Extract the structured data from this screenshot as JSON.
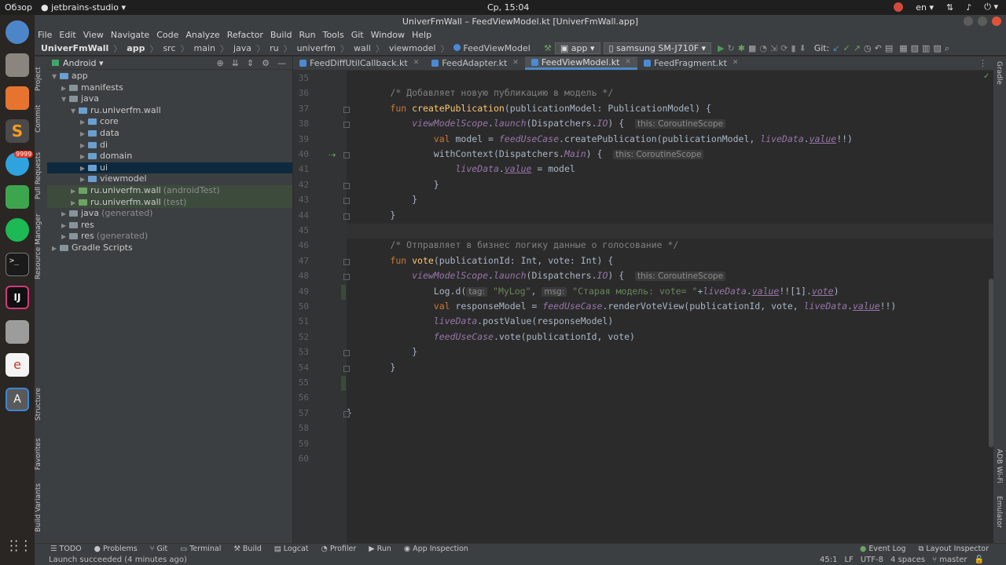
{
  "topbar": {
    "activities": "Обзор",
    "app": "jetbrains-studio",
    "clock": "Ср, 15:04",
    "lang": "en"
  },
  "dock": {
    "telegram_badge": "9999"
  },
  "window": {
    "title": "UniverFmWall – FeedViewModel.kt [UniverFmWall.app]"
  },
  "menu": [
    "File",
    "Edit",
    "View",
    "Navigate",
    "Code",
    "Analyze",
    "Refactor",
    "Build",
    "Run",
    "Tools",
    "Git",
    "Window",
    "Help"
  ],
  "breadcrumbs": [
    "UniverFmWall",
    "app",
    "src",
    "main",
    "java",
    "ru",
    "univerfm",
    "wall",
    "viewmodel",
    "FeedViewModel"
  ],
  "toolbar": {
    "config": "app",
    "device": "samsung SM-J710F",
    "git_label": "Git:"
  },
  "project": {
    "view": "Android",
    "tree": [
      {
        "label": "app",
        "extra": "",
        "indent": 0,
        "open": true,
        "icon": "module"
      },
      {
        "label": "manifests",
        "extra": "",
        "indent": 1,
        "open": false,
        "icon": "folder"
      },
      {
        "label": "java",
        "extra": "",
        "indent": 1,
        "open": true,
        "icon": "folder"
      },
      {
        "label": "ru.univerfm.wall",
        "extra": "",
        "indent": 2,
        "open": true,
        "icon": "package"
      },
      {
        "label": "core",
        "extra": "",
        "indent": 3,
        "open": false,
        "icon": "package"
      },
      {
        "label": "data",
        "extra": "",
        "indent": 3,
        "open": false,
        "icon": "package"
      },
      {
        "label": "di",
        "extra": "",
        "indent": 3,
        "open": false,
        "icon": "package"
      },
      {
        "label": "domain",
        "extra": "",
        "indent": 3,
        "open": false,
        "icon": "package"
      },
      {
        "label": "ui",
        "extra": "",
        "indent": 3,
        "open": false,
        "icon": "package",
        "selected": true
      },
      {
        "label": "viewmodel",
        "extra": "",
        "indent": 3,
        "open": false,
        "icon": "package"
      },
      {
        "label": "ru.univerfm.wall",
        "extra": "(androidTest)",
        "indent": 2,
        "open": false,
        "icon": "test",
        "highlight": true
      },
      {
        "label": "ru.univerfm.wall",
        "extra": "(test)",
        "indent": 2,
        "open": false,
        "icon": "test",
        "highlight": true
      },
      {
        "label": "java",
        "extra": "(generated)",
        "indent": 1,
        "open": false,
        "icon": "folder"
      },
      {
        "label": "res",
        "extra": "",
        "indent": 1,
        "open": false,
        "icon": "folder"
      },
      {
        "label": "res",
        "extra": "(generated)",
        "indent": 1,
        "open": false,
        "icon": "folder"
      },
      {
        "label": "Gradle Scripts",
        "extra": "",
        "indent": 0,
        "open": false,
        "icon": "gradle"
      }
    ]
  },
  "tabs": [
    {
      "label": "FeedDiffUtilCallback.kt",
      "active": false
    },
    {
      "label": "FeedAdapter.kt",
      "active": false
    },
    {
      "label": "FeedViewModel.kt",
      "active": true
    },
    {
      "label": "FeedFragment.kt",
      "active": false
    }
  ],
  "side_left": [
    "Project",
    "Commit",
    "Pull Requests",
    "Resource Manager",
    "Structure",
    "Favorites",
    "Build Variants"
  ],
  "side_right": [
    "Gradle",
    "ADB Wi-Fi",
    "Emulator"
  ],
  "editor": {
    "first_line": 35,
    "line_count": 26,
    "current_line": 45,
    "lines": {
      "36": "/* Добавляет новую публикацию в модель */",
      "37a": "fun",
      "37b": "createPublication",
      "37c": "(publicationModel: PublicationModel) {",
      "38a": "viewModelScope",
      "38b": "launch",
      "38c": "(Dispatchers.",
      "38d": "IO",
      "38e": ") {",
      "hint_scope": "this: CoroutineScope",
      "39a": "val",
      "39b": " model = ",
      "39c": "feedUseCase",
      "39d": ".createPublication(publicationModel, ",
      "39e": "liveData",
      "39f": "value",
      "39g": "!!)",
      "40a": "withContext(Dispatchers.",
      "40b": "Main",
      "40c": ") {",
      "41a": "liveData",
      "41b": "value",
      "41c": " = model",
      "46": "/* Отправляет в бизнес логику данные о голосование */",
      "47a": "fun",
      "47b": "vote",
      "47c": "(publicationId: Int, vote: Int) {",
      "49a": "Log.d(",
      "49tag": "tag:",
      "49b": "\"MyLog\"",
      "49msg": "msg:",
      "49c": "\"Старая модель: vote= \"",
      "49d": "+",
      "49e": "liveData",
      "49f": "value",
      "49g": "!![1].",
      "49h": "vote",
      "49i": ")",
      "50a": "val",
      "50b": " responseModel = ",
      "50c": "feedUseCase",
      "50d": ".renderVoteView(publicationId, vote, ",
      "50e": "liveData",
      "50f": "value",
      "50g": "!!)",
      "51a": "liveData",
      "51b": ".postValue(responseModel)",
      "52a": "feedUseCase",
      "52b": ".vote(publicationId, vote)",
      "brace_close": "}"
    }
  },
  "bottom_tools": [
    "TODO",
    "Problems",
    "Git",
    "Terminal",
    "Build",
    "Logcat",
    "Profiler",
    "Run",
    "App Inspection"
  ],
  "bottom_right": [
    "Event Log",
    "Layout Inspector"
  ],
  "status": {
    "message": "Launch succeeded (4 minutes ago)",
    "pos": "45:1",
    "eol": "LF",
    "enc": "UTF-8",
    "indent": "4 spaces",
    "branch": "master"
  },
  "colors": {
    "accent": "#4a88c7",
    "keyword": "#cc7832",
    "function": "#ffc66d",
    "comment": "#808080",
    "string": "#6a8759",
    "field": "#9876aa"
  }
}
